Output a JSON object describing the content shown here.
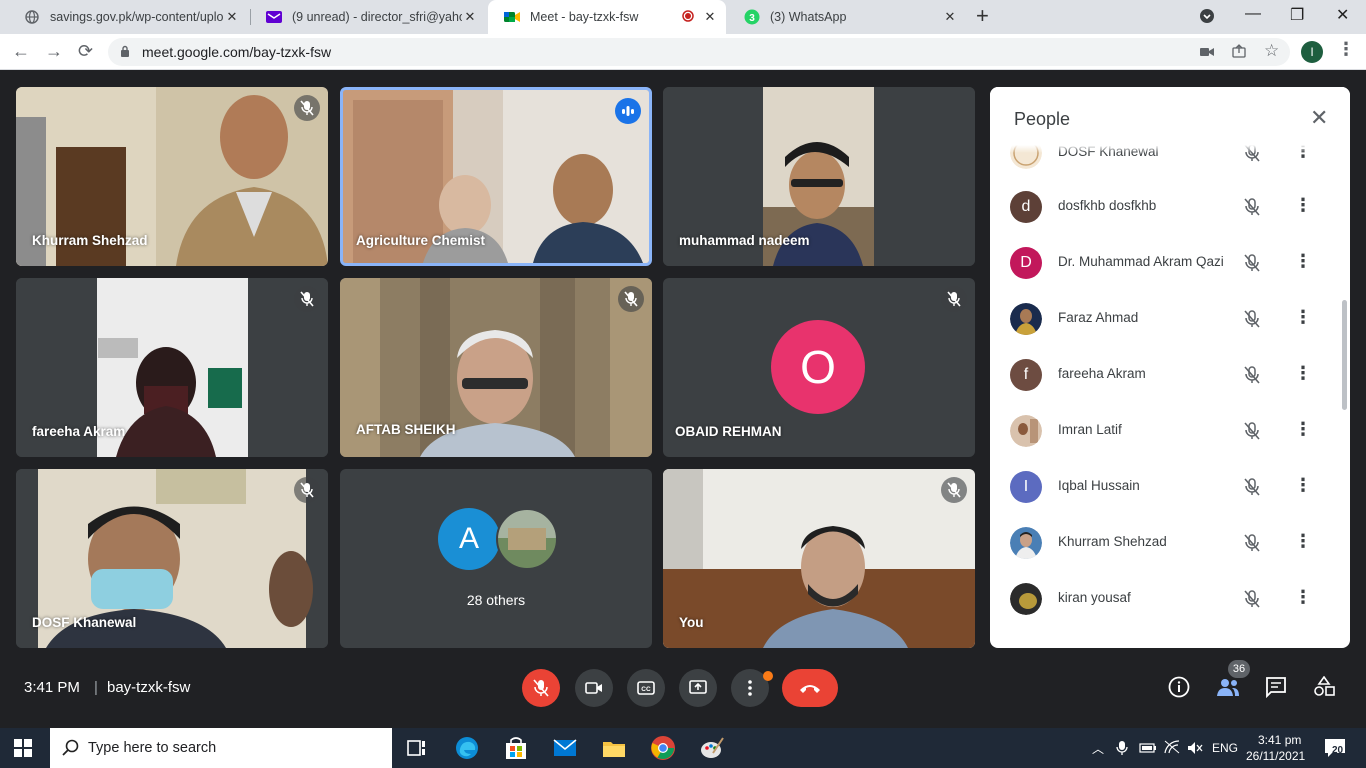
{
  "browser": {
    "tabs": [
      {
        "title": "savings.gov.pk/wp-content/uplo",
        "icon": "globe-icon"
      },
      {
        "title": "(9 unread) - director_sfri@yahoo",
        "icon": "yahoo-mail-icon"
      },
      {
        "title": "Meet - bay-tzxk-fsw",
        "icon": "google-meet-icon",
        "active": true
      },
      {
        "title": "(3) WhatsApp",
        "icon": "whatsapp-icon"
      }
    ],
    "url": "meet.google.com/bay-tzxk-fsw",
    "profile_initial": "I"
  },
  "tiles": [
    {
      "name": "Khurram Shehzad",
      "muted": true
    },
    {
      "name": "Agriculture Chemist",
      "speaking": true
    },
    {
      "name": "muhammad nadeem",
      "muted": false
    },
    {
      "name": "fareeha Akram",
      "muted": true
    },
    {
      "name": "AFTAB SHEIKH",
      "muted": true
    },
    {
      "name": "OBAID REHMAN",
      "muted": true,
      "avatar": "O",
      "avatar_color": "#e8336d"
    },
    {
      "name": "DOSF Khanewal",
      "muted": true
    },
    {
      "name": "28 others",
      "avatar": "A",
      "avatar_color": "#1a8fd5"
    },
    {
      "name": "You",
      "muted": true
    }
  ],
  "people_panel": {
    "title": "People",
    "participants": [
      {
        "name": "DOSF Khanewal",
        "avatar_type": "photo"
      },
      {
        "name": "dosfkhb dosfkhb",
        "initial": "d",
        "color": "#5d4037"
      },
      {
        "name": "Dr. Muhammad Akram Qazi",
        "initial": "D",
        "color": "#c2185b"
      },
      {
        "name": "Faraz Ahmad",
        "avatar_type": "photo"
      },
      {
        "name": "fareeha Akram",
        "initial": "f",
        "color": "#6d4c41"
      },
      {
        "name": "Imran Latif",
        "avatar_type": "photo"
      },
      {
        "name": "Iqbal Hussain",
        "initial": "I",
        "color": "#5c6bc0"
      },
      {
        "name": "Khurram Shehzad",
        "avatar_type": "photo"
      },
      {
        "name": "kiran yousaf",
        "avatar_type": "photo"
      }
    ]
  },
  "bottom_bar": {
    "time": "3:41 PM",
    "separator": "|",
    "meeting_code": "bay-tzxk-fsw",
    "participant_count": "36"
  },
  "taskbar": {
    "search_placeholder": "Type here to search",
    "language": "ENG",
    "clock_time": "3:41 pm",
    "clock_date": "26/11/2021",
    "notification_count": "20"
  }
}
